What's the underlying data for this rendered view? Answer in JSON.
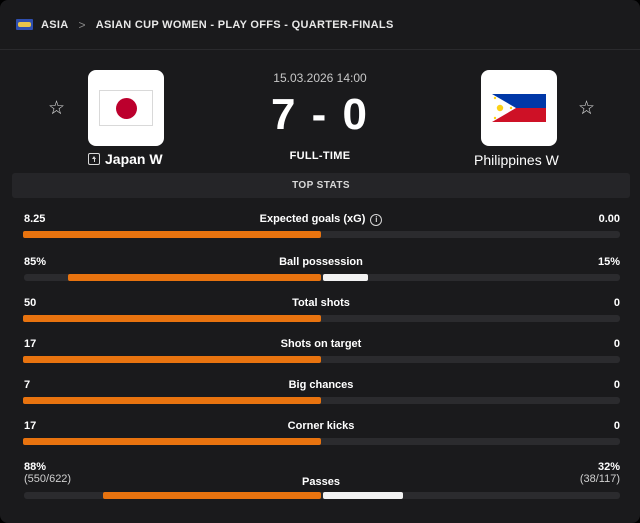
{
  "breadcrumb": {
    "region": "ASIA",
    "competition": "ASIAN CUP WOMEN - PLAY OFFS - QUARTER-FINALS",
    "separator": ">"
  },
  "match": {
    "datetime": "15.03.2026 14:00",
    "score": "7 - 0",
    "status": "FULL-TIME",
    "home": {
      "name": "Japan W",
      "flag": "japan-flag",
      "favorite_icon": "☆"
    },
    "away": {
      "name": "Philippines W",
      "flag": "philippines-flag",
      "favorite_icon": "☆"
    }
  },
  "stats_header": "TOP STATS",
  "colors": {
    "home_bar": "#e8730f",
    "away_bar": "#f2f2f2",
    "track": "#2b2b2e",
    "background": "#1a1a1c"
  },
  "stats": [
    {
      "label": "Expected goals (xG)",
      "home": "8.25",
      "away": "0.00",
      "home_share": 1.0,
      "away_share": 0.0,
      "info_icon": "i"
    },
    {
      "label": "Ball possession",
      "home": "85%",
      "away": "15%",
      "home_share": 0.85,
      "away_share": 0.15
    },
    {
      "label": "Total shots",
      "home": "50",
      "away": "0",
      "home_share": 1.0,
      "away_share": 0.0
    },
    {
      "label": "Shots on target",
      "home": "17",
      "away": "0",
      "home_share": 1.0,
      "away_share": 0.0
    },
    {
      "label": "Big chances",
      "home": "7",
      "away": "0",
      "home_share": 1.0,
      "away_share": 0.0
    },
    {
      "label": "Corner kicks",
      "home": "17",
      "away": "0",
      "home_share": 1.0,
      "away_share": 0.0
    },
    {
      "label": "Passes",
      "home": "88%",
      "home_sub": "(550/622)",
      "away": "32%",
      "away_sub": "(38/117)",
      "home_share": 0.73,
      "away_share": 0.27
    }
  ]
}
